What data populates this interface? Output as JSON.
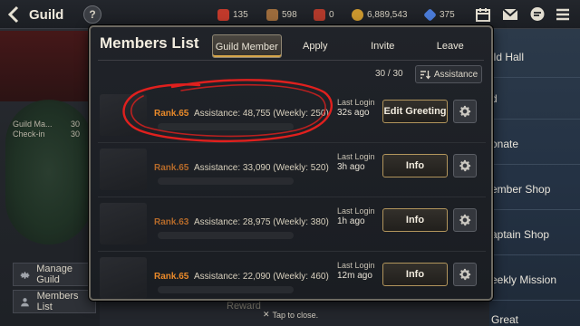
{
  "topbar": {
    "title": "Guild",
    "help": "?",
    "resources": [
      {
        "icon": "stamina-icon",
        "value": "135",
        "color": "#c0392b"
      },
      {
        "icon": "chest-icon",
        "value": "598",
        "color": "#9c6b3c"
      },
      {
        "icon": "crown-icon",
        "value": "0",
        "color": "#b0392b"
      },
      {
        "icon": "gold-coin-icon",
        "value": "6,889,543",
        "color": "#c9962e"
      },
      {
        "icon": "crystal-icon",
        "value": "375",
        "color": "#4a7ad6"
      }
    ]
  },
  "background": {
    "left_stats": [
      {
        "label": "Guild Ma...",
        "value": "30"
      },
      {
        "label": "Check-in",
        "value": "30"
      }
    ],
    "left_buttons": [
      {
        "label": "Manage Guild",
        "icon": "gear-icon"
      },
      {
        "label": "Members List",
        "icon": "people-icon"
      }
    ],
    "right_menu": [
      "ild Hall",
      "d",
      "onate",
      "ember Shop",
      "aptain Shop",
      "eekly Mission",
      "Great"
    ],
    "reward_label": "Reward",
    "tap_close": "Tap to close."
  },
  "modal": {
    "title": "Members List",
    "tabs": [
      {
        "label": "Guild Member",
        "active": true
      },
      {
        "label": "Apply",
        "active": false
      },
      {
        "label": "Invite",
        "active": false
      },
      {
        "label": "Leave",
        "active": false
      }
    ],
    "member_count": "30 / 30",
    "sort_label": "Assistance",
    "members": [
      {
        "rank": "Rank.65",
        "assistance": "Assistance: 48,755 (Weekly: 250)",
        "last_login_label": "Last Login",
        "last_login": "32s ago",
        "action": "Edit Greeting"
      },
      {
        "rank": "Rank.65",
        "assistance": "Assistance: 33,090 (Weekly: 520)",
        "last_login_label": "Last Login",
        "last_login": "3h ago",
        "action": "Info"
      },
      {
        "rank": "Rank.63",
        "assistance": "Assistance: 28,975 (Weekly: 380)",
        "last_login_label": "Last Login",
        "last_login": "1h ago",
        "action": "Info"
      },
      {
        "rank": "Rank.65",
        "assistance": "Assistance: 22,090 (Weekly: 460)",
        "last_login_label": "Last Login",
        "last_login": "12m ago",
        "action": "Info"
      }
    ]
  }
}
